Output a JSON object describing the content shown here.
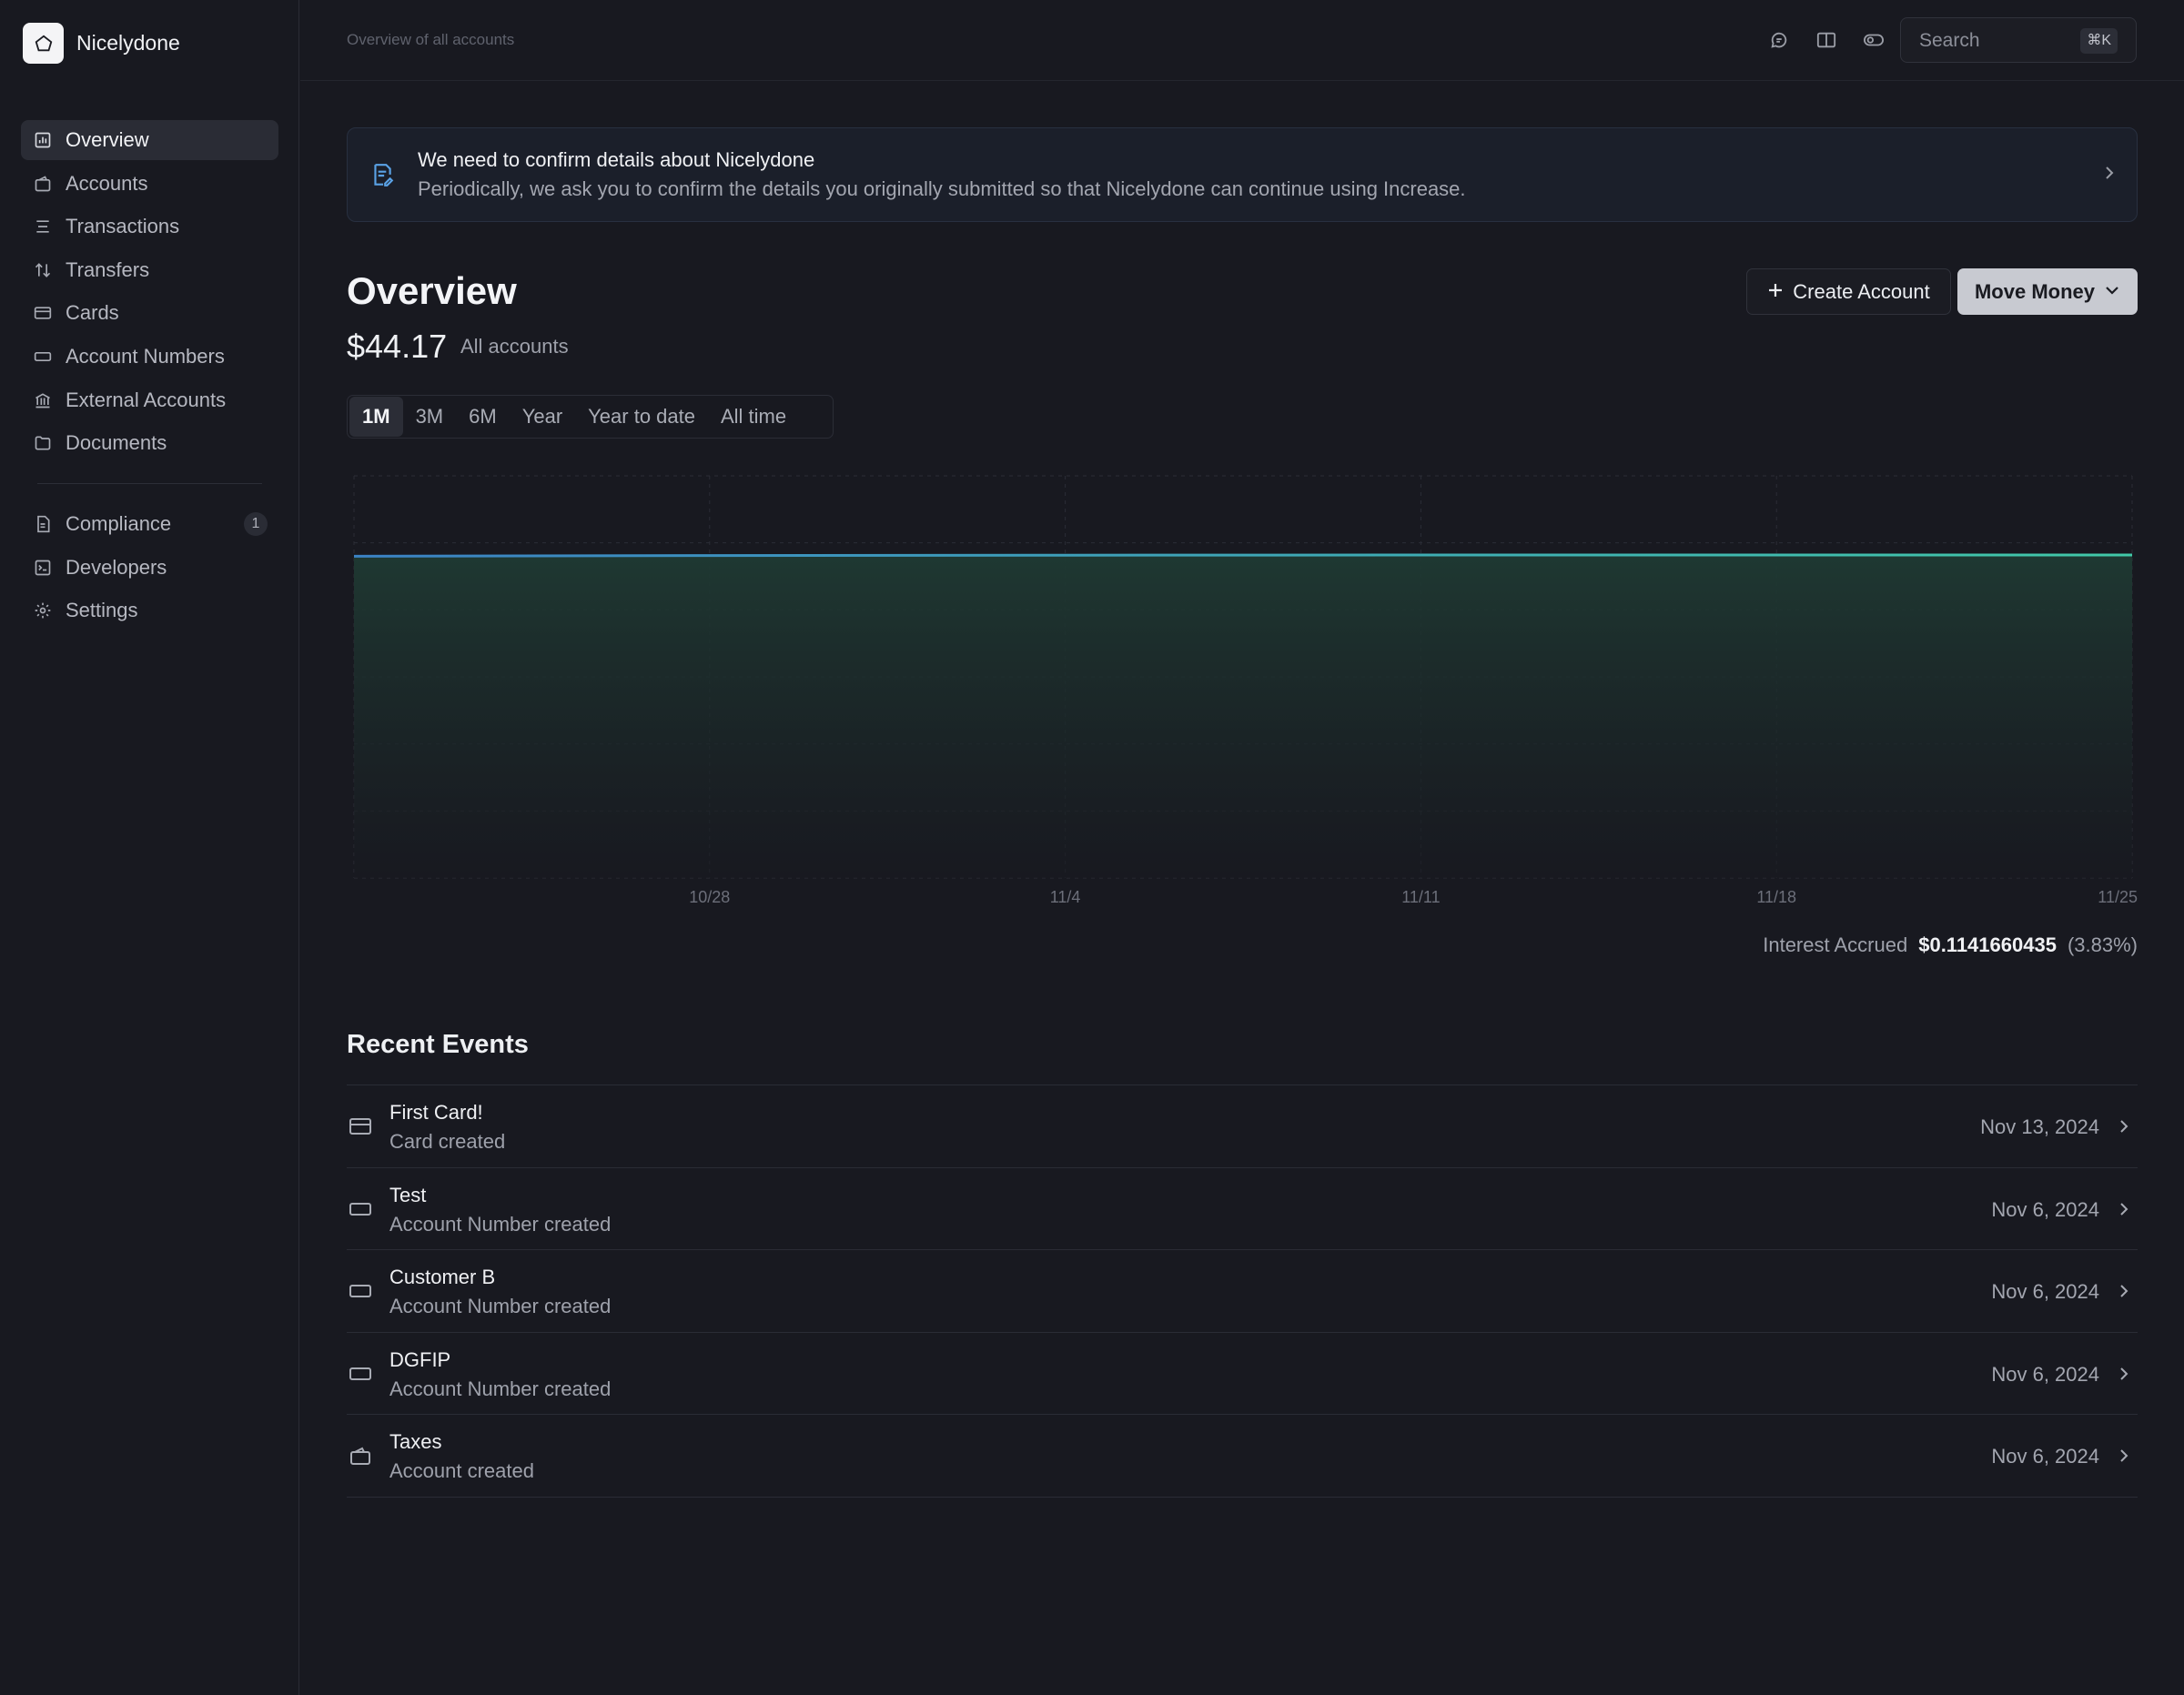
{
  "app": {
    "name": "Nicelydone"
  },
  "sidebar": {
    "items": [
      {
        "label": "Overview",
        "icon": "chart-bar-icon",
        "active": true
      },
      {
        "label": "Accounts",
        "icon": "wallet-icon"
      },
      {
        "label": "Transactions",
        "icon": "list-icon"
      },
      {
        "label": "Transfers",
        "icon": "arrows-up-down-icon"
      },
      {
        "label": "Cards",
        "icon": "credit-card-icon"
      },
      {
        "label": "Account Numbers",
        "icon": "keypad-icon"
      },
      {
        "label": "External Accounts",
        "icon": "bank-icon"
      },
      {
        "label": "Documents",
        "icon": "folder-icon"
      }
    ],
    "secondary": [
      {
        "label": "Compliance",
        "icon": "document-icon",
        "badge": "1"
      },
      {
        "label": "Developers",
        "icon": "terminal-icon"
      },
      {
        "label": "Settings",
        "icon": "gear-icon"
      }
    ]
  },
  "topbar": {
    "breadcrumb": "Overview of all accounts",
    "search_placeholder": "Search",
    "shortcut": "⌘K"
  },
  "banner": {
    "title": "We need to confirm details about Nicelydone",
    "subtitle": "Periodically, we ask you to confirm the details you originally submitted so that Nicelydone can continue using Increase."
  },
  "overview": {
    "title": "Overview",
    "balance": "$44.17",
    "balance_label": "All accounts",
    "create_account_label": "Create Account",
    "move_money_label": "Move Money",
    "ranges": [
      "1M",
      "3M",
      "6M",
      "Year",
      "Year to date",
      "All time"
    ],
    "active_range": "1M"
  },
  "chart_data": {
    "type": "area",
    "x_ticks": [
      "10/28",
      "11/4",
      "11/11",
      "11/18",
      "11/25"
    ],
    "series": [
      {
        "values": [
          44.0,
          44.1,
          44.15,
          44.17,
          44.17,
          44.17
        ]
      }
    ],
    "ylim": [
      0,
      55
    ],
    "grid": true,
    "colors": {
      "line_start": "#3b82c4",
      "line_end": "#41c9a8",
      "fill": "#1f3a33"
    }
  },
  "interest": {
    "label": "Interest Accrued",
    "value": "$0.1141660435",
    "percent": "(3.83%)"
  },
  "events": {
    "title": "Recent Events",
    "items": [
      {
        "name": "First Card!",
        "type": "Card created",
        "date": "Nov 13, 2024",
        "icon": "credit-card-icon"
      },
      {
        "name": "Test",
        "type": "Account Number created",
        "date": "Nov 6, 2024",
        "icon": "keypad-icon"
      },
      {
        "name": "Customer B",
        "type": "Account Number created",
        "date": "Nov 6, 2024",
        "icon": "keypad-icon"
      },
      {
        "name": "DGFIP",
        "type": "Account Number created",
        "date": "Nov 6, 2024",
        "icon": "keypad-icon"
      },
      {
        "name": "Taxes",
        "type": "Account created",
        "date": "Nov 6, 2024",
        "icon": "wallet-icon"
      }
    ]
  }
}
